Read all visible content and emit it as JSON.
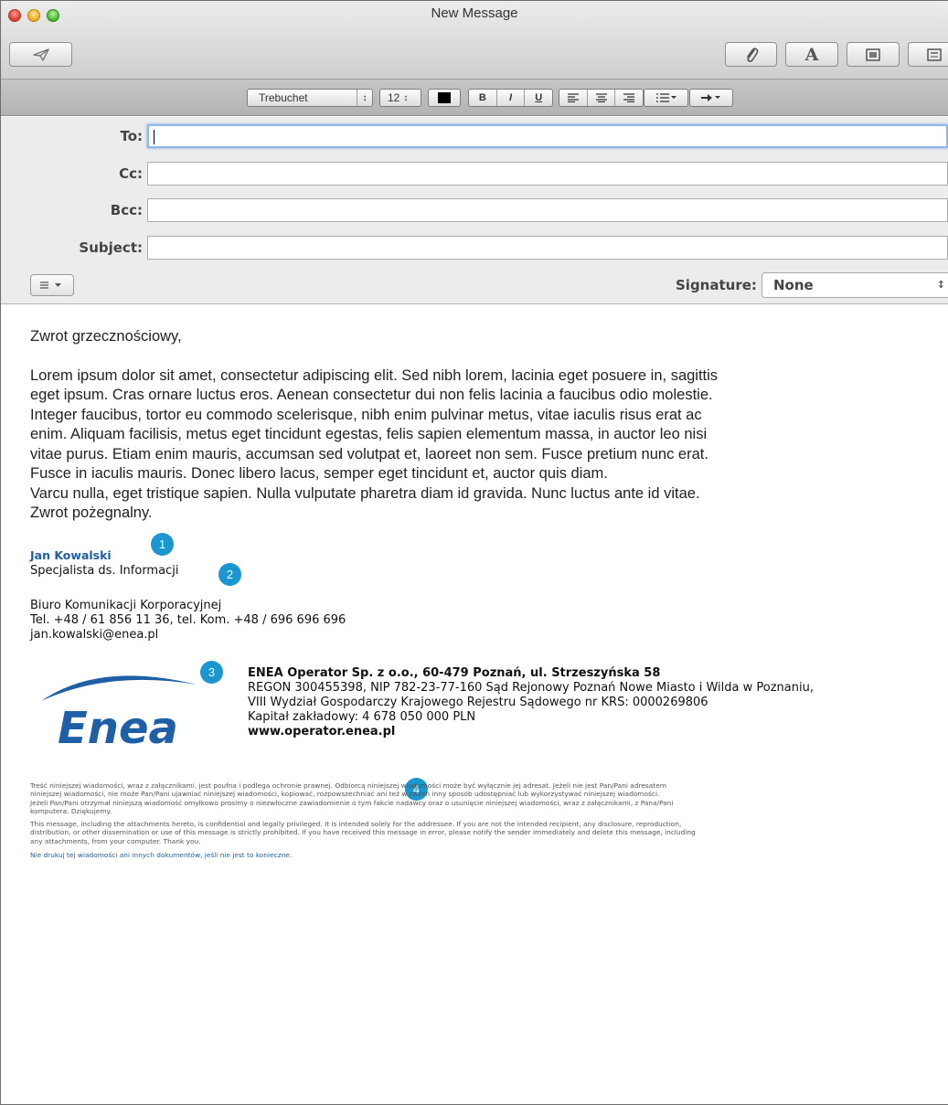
{
  "window": {
    "title": "New Message"
  },
  "toolbar": {
    "send_icon": "paper-plane-icon",
    "attach_icon": "paperclip-icon",
    "fonts_label": "A",
    "photo_icon": "photo-browser-icon",
    "template_icon": "stationery-icon"
  },
  "formatbar": {
    "font": "Trebuchet",
    "size": "12",
    "color": "#000000",
    "bold": "B",
    "italic": "I",
    "underline": "U"
  },
  "headers": {
    "to_label": "To:",
    "cc_label": "Cc:",
    "bcc_label": "Bcc:",
    "subject_label": "Subject:",
    "to_value": "",
    "cc_value": "",
    "bcc_value": "",
    "subject_value": "",
    "signature_label": "Signature:",
    "signature_value": "None"
  },
  "message": {
    "greeting": "Zwrot grzecznościowy,",
    "body_lines": [
      "Lorem ipsum dolor sit amet, consectetur adipiscing elit. Sed nibh lorem, lacinia eget posuere in, sagittis",
      "eget ipsum. Cras ornare luctus eros. Aenean consectetur dui non felis lacinia a faucibus odio molestie.",
      "Integer faucibus, tortor eu commodo scelerisque, nibh enim pulvinar metus, vitae iaculis risus erat ac",
      "enim. Aliquam facilisis, metus eget tincidunt egestas, felis sapien elementum massa, in auctor leo nisi",
      "vitae purus. Etiam enim mauris, accumsan sed volutpat et, laoreet non sem. Fusce pretium nunc erat.",
      "Fusce in iaculis mauris. Donec libero lacus, semper eget tincidunt et, auctor quis diam.",
      "Varcu nulla, eget tristique sapien. Nulla vulputate pharetra diam id gravida. Nunc luctus ante id vitae.",
      "Zwrot pożegnalny."
    ]
  },
  "signature": {
    "name": "Jan Kowalski",
    "title": "Specjalista ds. Informacji",
    "office": "Biuro Komunikacji Korporacyjnej",
    "phones": "Tel. +48 / 61 856 11 36, tel. Kom. +48 / 696 696 696",
    "email": "jan.kowalski@enea.pl"
  },
  "company": {
    "logo_text": "Enea",
    "line1": "ENEA Operator Sp. z o.o., 60-479 Poznań, ul. Strzeszyńska 58",
    "line2": "REGON 300455398, NIP 782-23-77-160 Sąd Rejonowy Poznań Nowe Miasto i Wilda w Poznaniu,",
    "line3": "VIII Wydział Gospodarczy Krajowego Rejestru Sądowego nr KRS: 0000269806",
    "line4": "Kapitał zakładowy: 4 678 050 000 PLN",
    "website": "www.operator.enea.pl"
  },
  "legal": {
    "pl_lines": [
      "Treść niniejszej wiadomości, wraz z załącznikami, jest poufna i podlega ochronie prawnej. Odbiorcą niniejszej wiadomości może być wyłącznie jej adresat. Jeżeli nie jest Pan/Pani adresatem",
      "niniejszej wiadomości, nie może Pan/Pani ujawniać niniejszej wiadomości, kopiować, rozpowszechniać ani też w żaden inny sposób udostępniać lub wykorzystywać niniejszej wiadomości.",
      "Jeżeli Pan/Pani otrzymał niniejszą wiadomość omyłkowo prosimy o niezwłoczne zawiadomienie o tym fakcie nadawcy oraz o usunięcie niniejszej wiadomości, wraz z załącznikami, z Pana/Pani",
      "komputera. Dziękujemy."
    ],
    "en_lines": [
      "This message, including the attachments hereto, is confidential and legally privileged. It is intended solely for the addressee. If you are not the intended recipient, any disclosure, reproduction,",
      "distribution, or other dissemination or use of this message is strictly prohibited. If you have received this message in error, please notify the sender immediately and delete this message, including",
      "any attachments, from your computer. Thank you."
    ],
    "print_note": "Nie drukuj tej wiadomości ani innych dokumentów, jeśli nie jest to konieczne."
  },
  "annotations": [
    "1",
    "2",
    "3",
    "4"
  ],
  "colors": {
    "accent": "#1a96d1",
    "signature_blue": "#1f5fa5",
    "logo_blue": "#1f5fa5"
  }
}
